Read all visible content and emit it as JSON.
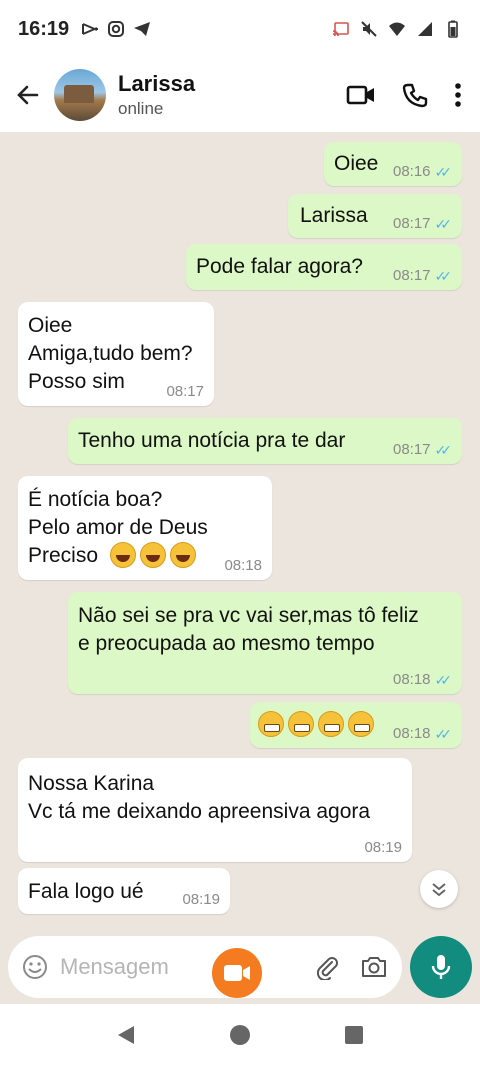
{
  "status_bar": {
    "time": "16:19",
    "left_icons": [
      "capcut-icon",
      "instagram-icon",
      "telegram-icon"
    ],
    "right_icons": [
      "cast-icon",
      "mute-icon",
      "wifi-icon",
      "signal-icon",
      "battery-icon"
    ]
  },
  "header": {
    "contact_name": "Larissa",
    "presence": "online",
    "actions": [
      "video-call-icon",
      "phone-icon",
      "more-vert-icon"
    ]
  },
  "messages": [
    {
      "dir": "out",
      "text": "Oiee",
      "time": "08:16",
      "read": true
    },
    {
      "dir": "out",
      "text": "Larissa",
      "time": "08:17",
      "read": true
    },
    {
      "dir": "out",
      "text": "Pode falar agora?",
      "time": "08:17",
      "read": true
    },
    {
      "dir": "in",
      "text": "Oiee\nAmiga,tudo bem?\nPosso sim",
      "time": "08:17"
    },
    {
      "dir": "out",
      "text": "Tenho uma notícia pra te dar",
      "time": "08:17",
      "read": true
    },
    {
      "dir": "in",
      "text": "É notícia boa?\nPelo amor de Deus\nPreciso",
      "emoji": [
        "smiley",
        "smiley",
        "smiley"
      ],
      "time": "08:18"
    },
    {
      "dir": "out",
      "text": "Não sei se pra vc vai ser,mas tô feliz\ne preocupada ao mesmo tempo",
      "time": "08:18",
      "read": true
    },
    {
      "dir": "out",
      "text": "",
      "emoji": [
        "grimace",
        "grimace",
        "grimace",
        "grimace"
      ],
      "time": "08:18",
      "read": true
    },
    {
      "dir": "in",
      "text": "Nossa Karina\nVc tá me deixando apreensiva agora",
      "time": "08:19"
    },
    {
      "dir": "in",
      "text": "Fala logo ué",
      "time": "08:19"
    }
  ],
  "composer": {
    "placeholder": "Mensagem",
    "icons": [
      "emoji-icon",
      "attach-icon",
      "camera-icon"
    ],
    "send_icon": "mic-icon"
  },
  "colors": {
    "outgoing_bubble": "#dcf8c6",
    "incoming_bubble": "#ffffff",
    "chat_background": "#ece5dd",
    "read_ticks": "#4fb6ec",
    "mic_button": "#128c7e",
    "record_button": "#f47b20"
  },
  "nav_bar": {
    "buttons": [
      "back-triangle-icon",
      "home-circle-icon",
      "recents-square-icon"
    ]
  }
}
